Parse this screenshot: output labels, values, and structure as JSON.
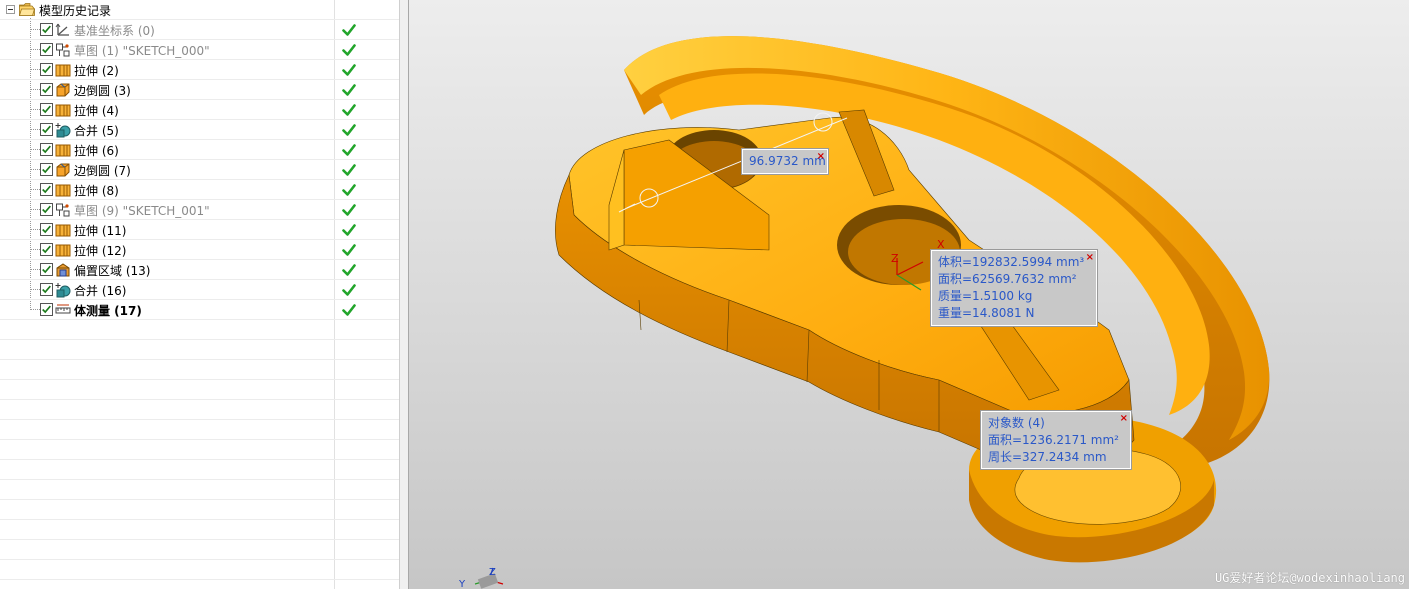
{
  "tree": {
    "root_label": "模型历史记录",
    "items": [
      {
        "label": "基准坐标系 (0)",
        "icon": "datum-csys-icon",
        "dim": true,
        "bold": false
      },
      {
        "label": "草图 (1) \"SKETCH_000\"",
        "icon": "sketch-icon",
        "dim": true,
        "bold": false
      },
      {
        "label": "拉伸 (2)",
        "icon": "extrude-icon",
        "dim": false,
        "bold": false
      },
      {
        "label": "边倒圆 (3)",
        "icon": "edge-blend-icon",
        "dim": false,
        "bold": false
      },
      {
        "label": "拉伸 (4)",
        "icon": "extrude-icon",
        "dim": false,
        "bold": false
      },
      {
        "label": "合并 (5)",
        "icon": "unite-icon",
        "dim": false,
        "bold": false
      },
      {
        "label": "拉伸 (6)",
        "icon": "extrude-icon",
        "dim": false,
        "bold": false
      },
      {
        "label": "边倒圆 (7)",
        "icon": "edge-blend-icon",
        "dim": false,
        "bold": false
      },
      {
        "label": "拉伸 (8)",
        "icon": "extrude-icon",
        "dim": false,
        "bold": false
      },
      {
        "label": "草图 (9) \"SKETCH_001\"",
        "icon": "sketch-icon",
        "dim": true,
        "bold": false
      },
      {
        "label": "拉伸 (11)",
        "icon": "extrude-icon",
        "dim": false,
        "bold": false
      },
      {
        "label": "拉伸 (12)",
        "icon": "extrude-icon",
        "dim": false,
        "bold": false
      },
      {
        "label": "偏置区域 (13)",
        "icon": "offset-region-icon",
        "dim": false,
        "bold": false
      },
      {
        "label": "合并 (16)",
        "icon": "unite-icon",
        "dim": false,
        "bold": false
      },
      {
        "label": "体测量 (17)",
        "icon": "body-measure-icon",
        "dim": false,
        "bold": true
      }
    ],
    "empty_rows": 14
  },
  "viewport": {
    "distance": "96.9732 mm",
    "body_measure": {
      "volume": "体积=192832.5994 mm³",
      "area": "面积=62569.7632 mm²",
      "mass": "质量=1.5100 kg",
      "weight": "重量=14.8081 N"
    },
    "face_measure": {
      "count": "对象数 (4)",
      "area": "面积=1236.2171 mm²",
      "perimeter": "周长=327.2434 mm"
    },
    "close_glyph": "×",
    "axis_labels": {
      "x": "X",
      "y": "Y",
      "z": "Z"
    },
    "watermark": "UG爱好者论坛@wodexinhaoliang"
  },
  "colors": {
    "part_light": "#ffb515",
    "part_mid": "#f5a000",
    "part_dark": "#cf7d00",
    "check_green": "#22a52b",
    "callout_text": "#2a58c8"
  }
}
